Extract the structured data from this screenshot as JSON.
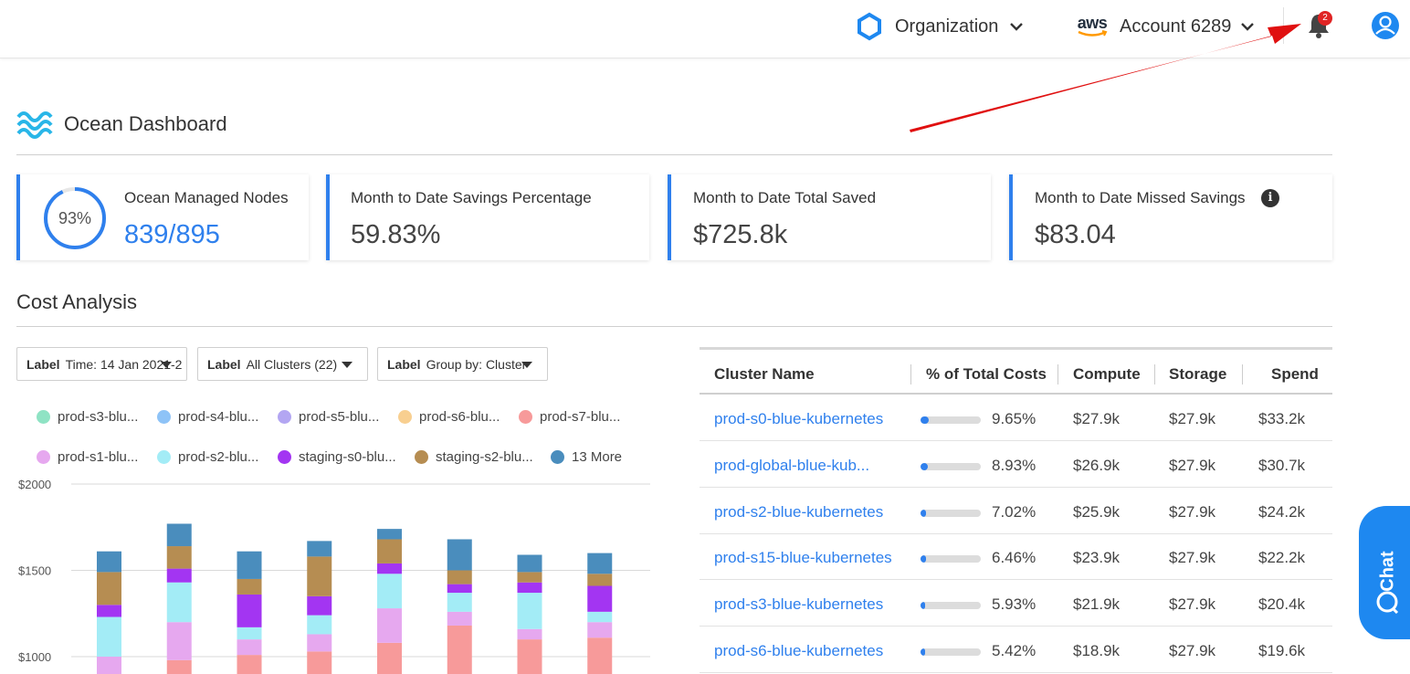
{
  "topbar": {
    "org_label": "Organization",
    "aws_logo_text": "aws",
    "account_label": "Account 6289",
    "notifications_count": "2"
  },
  "page": {
    "title": "Ocean Dashboard"
  },
  "cards": [
    {
      "label": "Ocean Managed Nodes",
      "value": "839/895",
      "ring_text": "93%",
      "ring_percent": 93
    },
    {
      "label": "Month to Date Savings Percentage",
      "value": "59.83%"
    },
    {
      "label": "Month to Date Total Saved",
      "value": "$725.8k"
    },
    {
      "label": "Month to Date Missed Savings",
      "value": "$83.04",
      "info_icon": "i"
    }
  ],
  "cost_analysis": {
    "title": "Cost Analysis",
    "filters": [
      {
        "label": "Label",
        "value": "Time: 14 Jan 2021-2"
      },
      {
        "label": "Label",
        "value": "All Clusters (22)"
      },
      {
        "label": "Label",
        "value": "Group by: Cluster"
      }
    ]
  },
  "legend": [
    {
      "name": "prod-s3-blu...",
      "color": "#8fe3c4"
    },
    {
      "name": "prod-s4-blu...",
      "color": "#8ec3f7"
    },
    {
      "name": "prod-s5-blu...",
      "color": "#b3a6f2"
    },
    {
      "name": "prod-s6-blu...",
      "color": "#f8cf90"
    },
    {
      "name": "prod-s7-blu...",
      "color": "#f79a9a"
    },
    {
      "name": "prod-s1-blu...",
      "color": "#e6a8ef"
    },
    {
      "name": "prod-s2-blu...",
      "color": "#a3ecf6"
    },
    {
      "name": "staging-s0-blu...",
      "color": "#a335f2"
    },
    {
      "name": "staging-s2-blu...",
      "color": "#b68d52"
    },
    {
      "name": "13 More",
      "color": "#4a8dbd"
    }
  ],
  "chart_data": {
    "type": "bar",
    "stacked": true,
    "ylim": [
      900,
      2000
    ],
    "yticks": [
      {
        "label": "$2000",
        "value": 2000
      },
      {
        "label": "$1500",
        "value": 1500
      },
      {
        "label": "$1000",
        "value": 1000
      }
    ],
    "series_colors": [
      "#f79a9a",
      "#f8cf90",
      "#e6a8ef",
      "#a3ecf6",
      "#a335f2",
      "#b68d52",
      "#4a8dbd"
    ],
    "series": [
      {
        "name": "prod-s7-blu...",
        "values": [
          0,
          980,
          1010,
          1030,
          1080,
          1180,
          1100,
          1110
        ]
      },
      {
        "name": "prod-s6-blu...",
        "values": [
          0,
          0,
          0,
          0,
          980,
          980,
          0,
          0
        ]
      },
      {
        "name": "prod-s1-blu...",
        "values": [
          1000,
          1200,
          1100,
          1130,
          1280,
          1260,
          1160,
          1200
        ]
      },
      {
        "name": "prod-s2-blu...",
        "values": [
          1230,
          1430,
          1170,
          1240,
          1480,
          1370,
          1370,
          1260
        ]
      },
      {
        "name": "staging-s0-blu...",
        "values": [
          1300,
          1510,
          1360,
          1350,
          1540,
          1420,
          1430,
          1410
        ]
      },
      {
        "name": "staging-s2-blu...",
        "values": [
          1490,
          1640,
          1450,
          1580,
          1680,
          1500,
          1490,
          1480
        ]
      },
      {
        "name": "13 More",
        "values": [
          1610,
          1770,
          1610,
          1670,
          1740,
          1680,
          1590,
          1600
        ]
      }
    ]
  },
  "table": {
    "headers": [
      "Cluster Name",
      "% of Total Costs",
      "Compute",
      "Storage",
      "Spend"
    ],
    "rows": [
      {
        "name": "prod-s0-blue-kubernetes",
        "pct": "9.65%",
        "pct_value": 9.65,
        "compute": "$27.9k",
        "storage": "$27.9k",
        "spend": "$33.2k"
      },
      {
        "name": "prod-global-blue-kub...",
        "pct": "8.93%",
        "pct_value": 8.93,
        "compute": "$26.9k",
        "storage": "$27.9k",
        "spend": "$30.7k"
      },
      {
        "name": "prod-s2-blue-kubernetes",
        "pct": "7.02%",
        "pct_value": 7.02,
        "compute": "$25.9k",
        "storage": "$27.9k",
        "spend": "$24.2k"
      },
      {
        "name": "prod-s15-blue-kubernetes",
        "pct": "6.46%",
        "pct_value": 6.46,
        "compute": "$23.9k",
        "storage": "$27.9k",
        "spend": "$22.2k"
      },
      {
        "name": "prod-s3-blue-kubernetes",
        "pct": "5.93%",
        "pct_value": 5.93,
        "compute": "$21.9k",
        "storage": "$27.9k",
        "spend": "$20.4k"
      },
      {
        "name": "prod-s6-blue-kubernetes",
        "pct": "5.42%",
        "pct_value": 5.42,
        "compute": "$18.9k",
        "storage": "$27.9k",
        "spend": "$19.6k"
      }
    ]
  },
  "chat": {
    "label": "Chat"
  },
  "colors": {
    "accent": "#2f80ed",
    "badge": "#e02424",
    "annotation_arrow": "#e01010",
    "chat": "#1e88f0"
  }
}
